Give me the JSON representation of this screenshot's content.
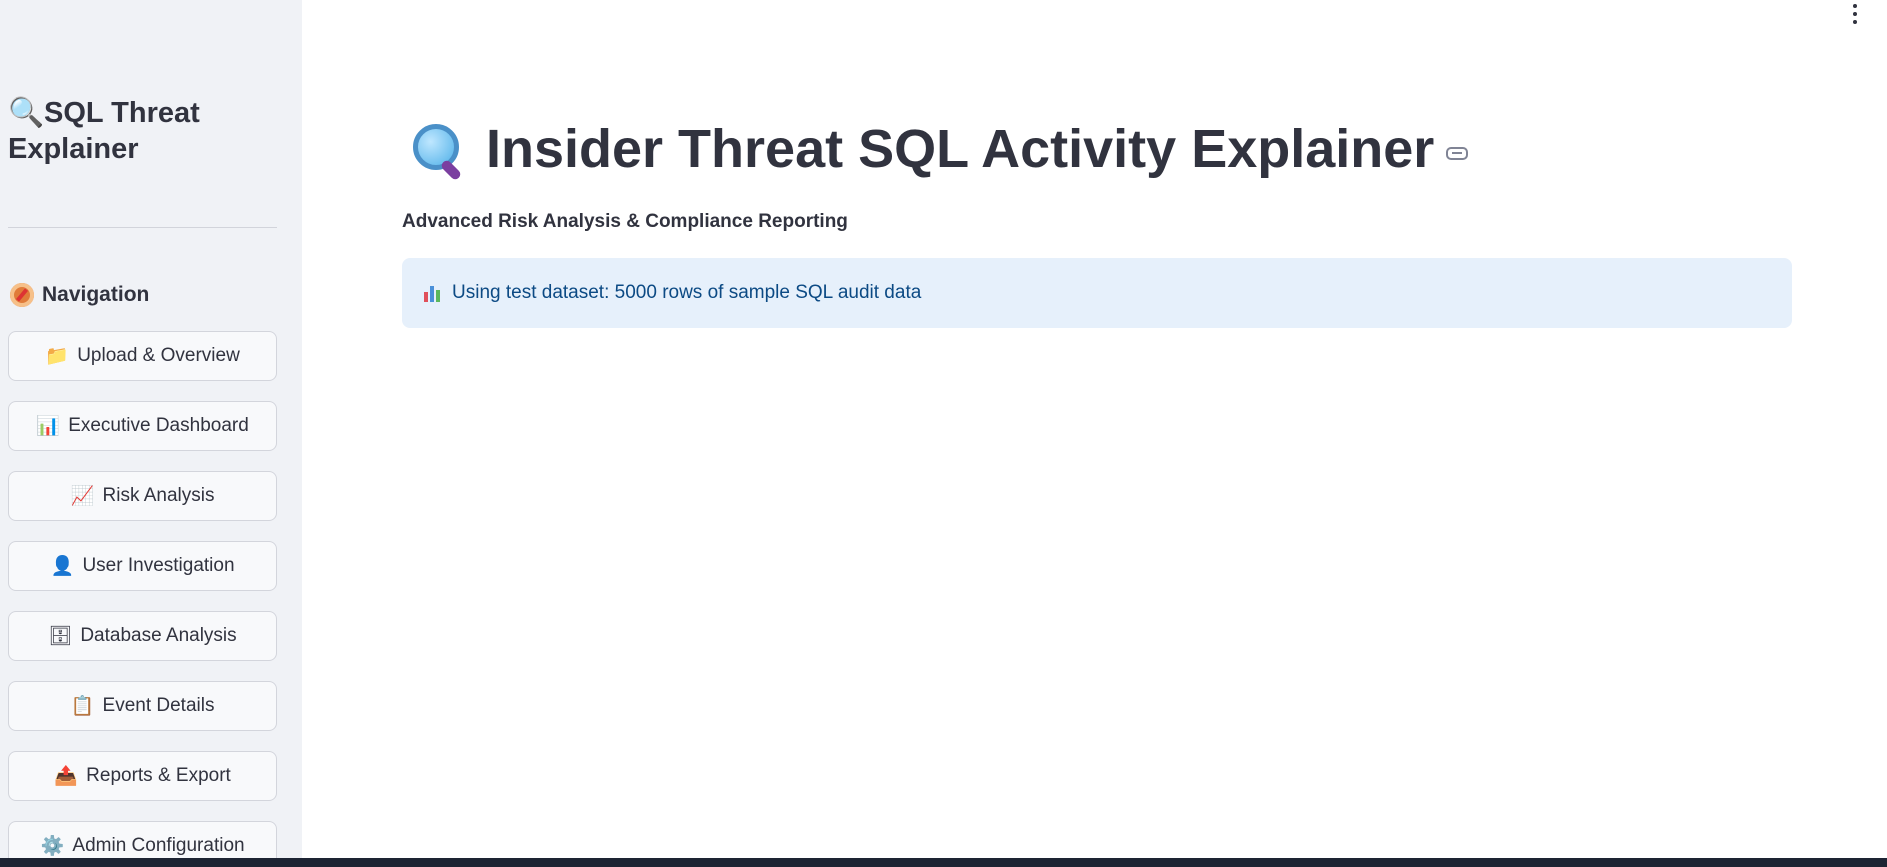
{
  "sidebar": {
    "title_icon": "magnifying-glass-icon",
    "title": "SQL Threat Explainer",
    "nav_heading_icon": "compass-icon",
    "nav_heading": "Navigation",
    "items": [
      {
        "icon": "📁",
        "icon_name": "folder-icon",
        "label": "Upload & Overview"
      },
      {
        "icon": "📊",
        "icon_name": "bar-chart-icon",
        "label": "Executive Dashboard"
      },
      {
        "icon": "📈",
        "icon_name": "trend-chart-icon",
        "label": "Risk Analysis"
      },
      {
        "icon": "👤",
        "icon_name": "user-icon",
        "label": "User Investigation"
      },
      {
        "icon": "🗄",
        "icon_name": "database-icon",
        "label": "Database Analysis"
      },
      {
        "icon": "📋",
        "icon_name": "clipboard-icon",
        "label": "Event Details"
      },
      {
        "icon": "📤",
        "icon_name": "export-tray-icon",
        "label": "Reports & Export"
      },
      {
        "icon": "⚙️",
        "icon_name": "gear-icon",
        "label": "Admin Configuration"
      }
    ]
  },
  "main": {
    "title_icon": "magnifying-glass-icon",
    "title": "Insider Threat SQL Activity Explainer",
    "subtitle": "Advanced Risk Analysis & Compliance Reporting",
    "info": {
      "icon": "bar-chart-icon",
      "text": "Using test dataset: 5000 rows of sample SQL audit data"
    }
  },
  "colors": {
    "sidebar_bg": "#f0f2f6",
    "info_bg": "#e6f0fb",
    "info_text": "#0c4a84",
    "text": "#31333f"
  }
}
